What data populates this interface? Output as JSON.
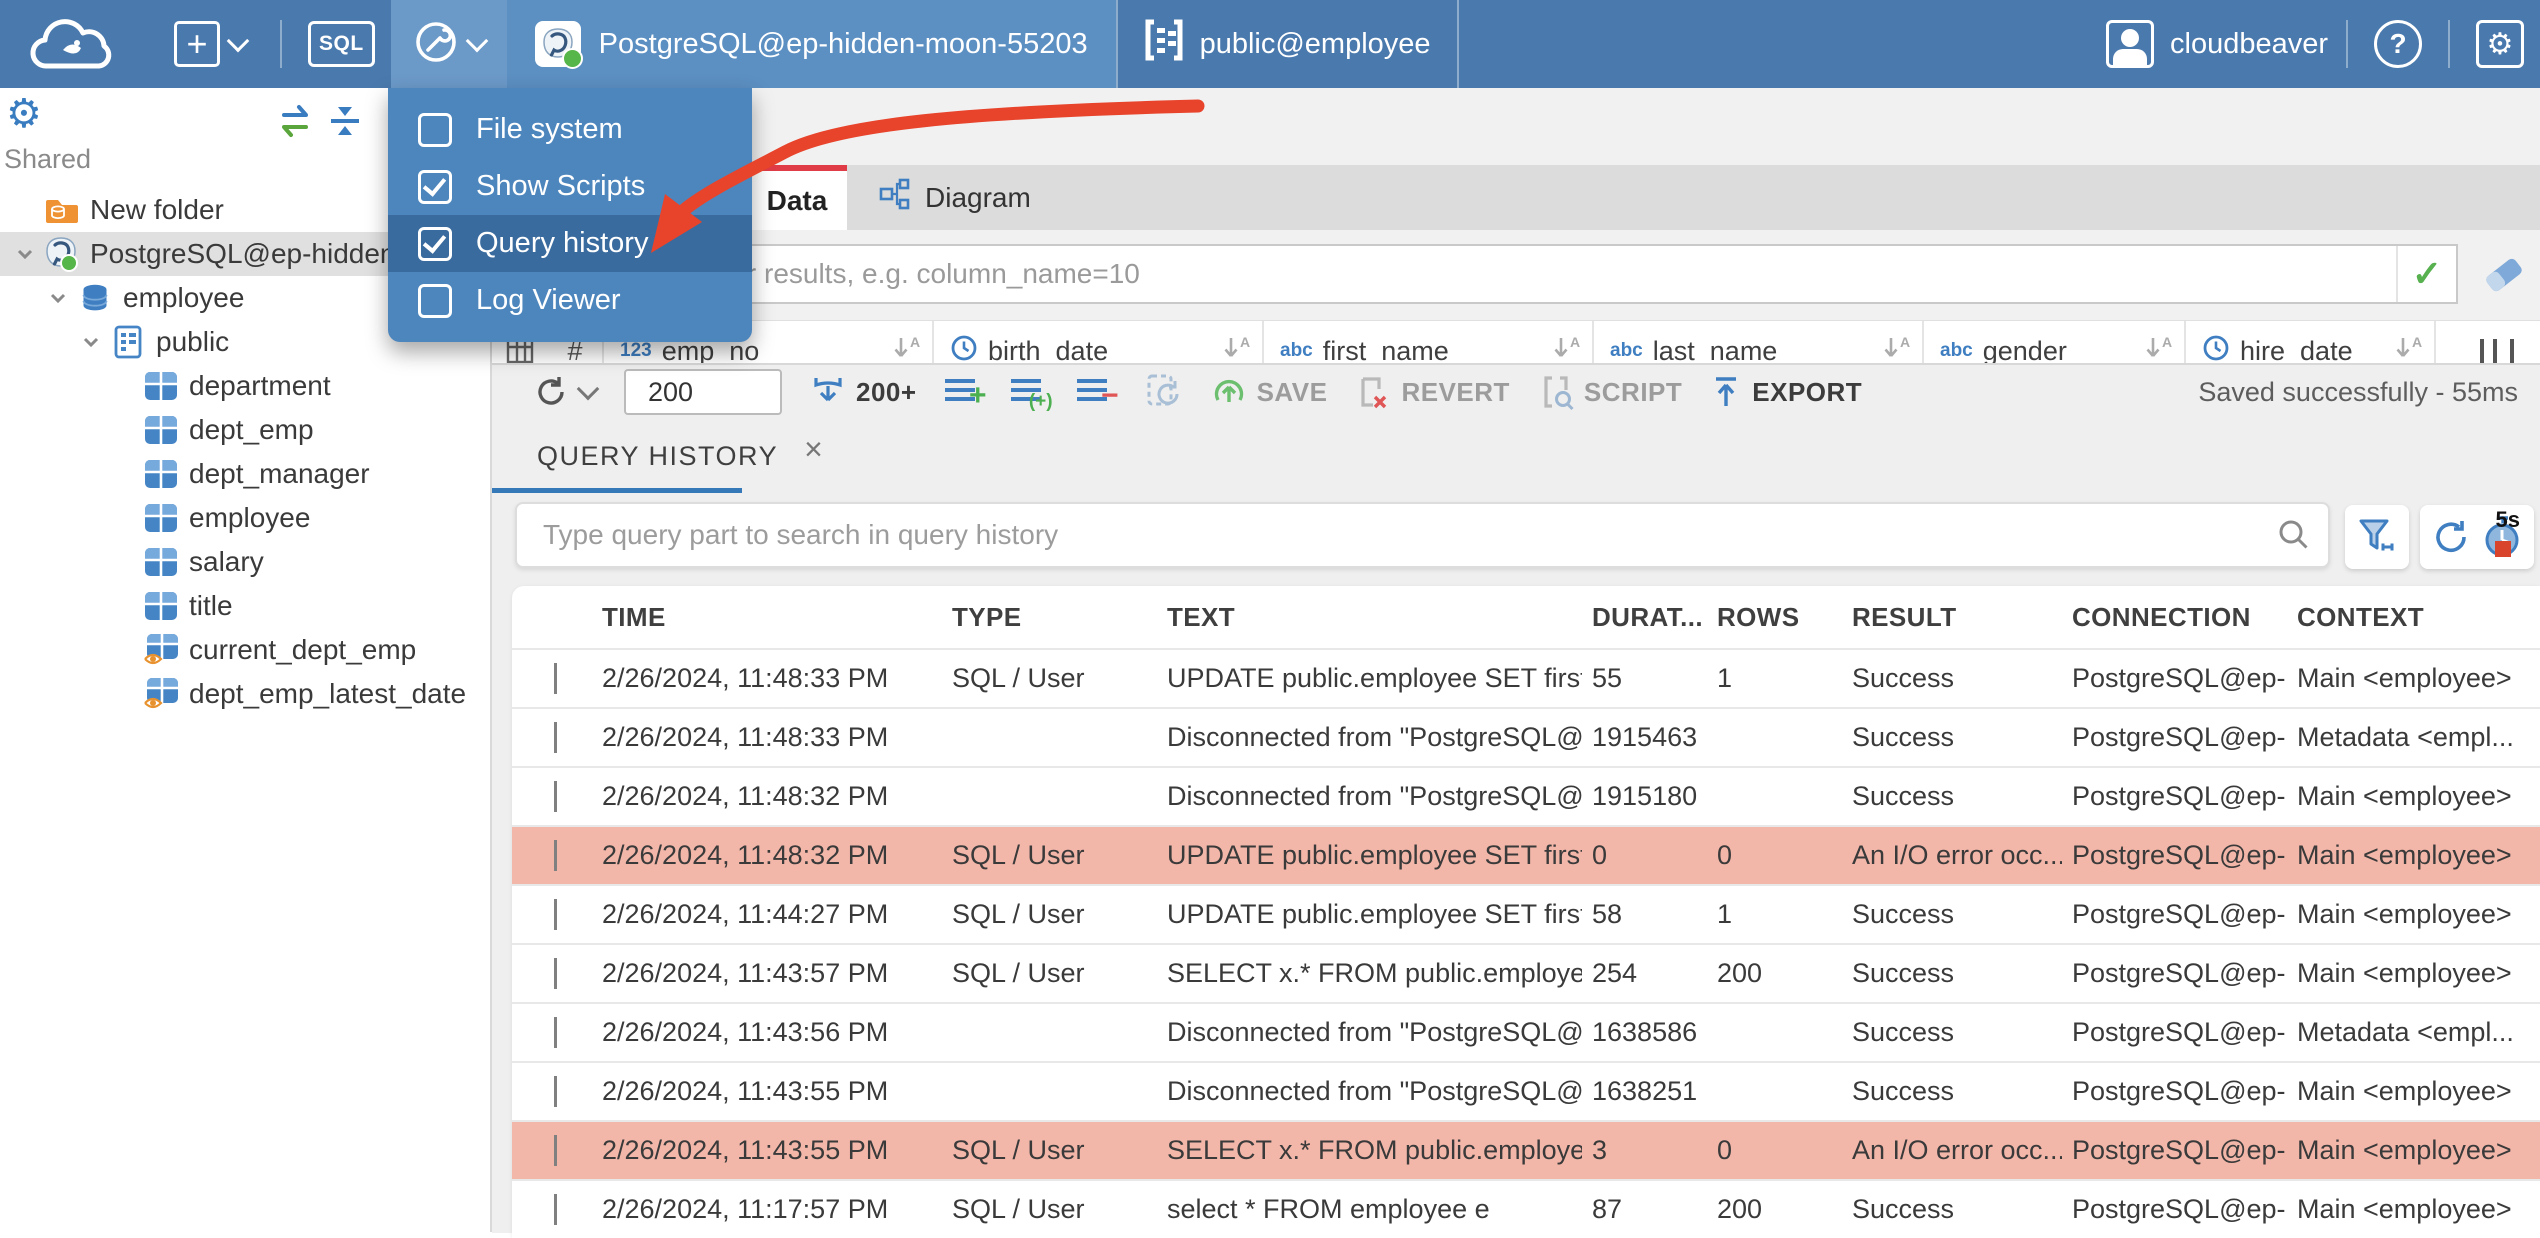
{
  "topbar": {
    "sql_button": "SQL",
    "connection": "PostgreSQL@ep-hidden-moon-55203",
    "schema": "public@employee",
    "user": "cloudbeaver"
  },
  "tools_menu": {
    "items": [
      {
        "label": "File system",
        "checked": false,
        "highlighted": false
      },
      {
        "label": "Show Scripts",
        "checked": true,
        "highlighted": false
      },
      {
        "label": "Query history",
        "checked": true,
        "highlighted": true
      },
      {
        "label": "Log Viewer",
        "checked": false,
        "highlighted": false
      }
    ]
  },
  "sidebar": {
    "section": "Shared",
    "tree": [
      {
        "label": "New folder",
        "icon": "folder",
        "indent": 1,
        "chevron": false,
        "selected": false
      },
      {
        "label": "PostgreSQL@ep-hidden-moon-55203",
        "icon": "postgres",
        "indent": 1,
        "chevron": true,
        "selected": true
      },
      {
        "label": "employee",
        "icon": "database",
        "indent": 2,
        "chevron": true,
        "selected": false
      },
      {
        "label": "public",
        "icon": "schema",
        "indent": 3,
        "chevron": true,
        "selected": false
      },
      {
        "label": "department",
        "icon": "table",
        "indent": 4,
        "chevron": false,
        "selected": false
      },
      {
        "label": "dept_emp",
        "icon": "table",
        "indent": 4,
        "chevron": false,
        "selected": false
      },
      {
        "label": "dept_manager",
        "icon": "table",
        "indent": 4,
        "chevron": false,
        "selected": false
      },
      {
        "label": "employee",
        "icon": "table",
        "indent": 4,
        "chevron": false,
        "selected": false
      },
      {
        "label": "salary",
        "icon": "table",
        "indent": 4,
        "chevron": false,
        "selected": false
      },
      {
        "label": "title",
        "icon": "table",
        "indent": 4,
        "chevron": false,
        "selected": false
      },
      {
        "label": "current_dept_emp",
        "icon": "view",
        "indent": 4,
        "chevron": false,
        "selected": false
      },
      {
        "label": "dept_emp_latest_date",
        "icon": "view",
        "indent": 4,
        "chevron": false,
        "selected": false
      }
    ]
  },
  "main": {
    "tabs": [
      {
        "label": "Data",
        "active": true
      },
      {
        "label": "Diagram",
        "active": false
      }
    ],
    "filter_placeholder": "expression to filter results, e.g. column_name=10",
    "datagrid_columns": [
      {
        "type": "num",
        "label": "emp_no"
      },
      {
        "type": "date",
        "label": "birth_date"
      },
      {
        "type": "text",
        "label": "first_name"
      },
      {
        "type": "text",
        "label": "last_name"
      },
      {
        "type": "text",
        "label": "gender"
      },
      {
        "type": "date",
        "label": "hire_date"
      }
    ],
    "toolbar": {
      "row_count": "200",
      "load_more": "200+",
      "save": "SAVE",
      "revert": "REVERT",
      "script": "SCRIPT",
      "export": "EXPORT",
      "status": "Saved successfully - 55ms"
    }
  },
  "history": {
    "tab": "QUERY HISTORY",
    "search_placeholder": "Type query part to search in query history",
    "refresh_interval": "5s",
    "columns": [
      "TIME",
      "TYPE",
      "TEXT",
      "DURAT...",
      "ROWS",
      "RESULT",
      "CONNECTION",
      "CONTEXT"
    ],
    "rows": [
      {
        "time": "2/26/2024, 11:48:33 PM",
        "type": "SQL / User",
        "text": "UPDATE public.employee SET first_...",
        "duration": "55",
        "rows": "1",
        "result": "Success",
        "connection": "PostgreSQL@ep-...",
        "context": "Main <employee>",
        "error": false
      },
      {
        "time": "2/26/2024, 11:48:33 PM",
        "type": "",
        "text": "Disconnected from \"PostgreSQL@e...",
        "duration": "1915463",
        "rows": "",
        "result": "Success",
        "connection": "PostgreSQL@ep-...",
        "context": "Metadata <empl...",
        "error": false
      },
      {
        "time": "2/26/2024, 11:48:32 PM",
        "type": "",
        "text": "Disconnected from \"PostgreSQL@e...",
        "duration": "1915180",
        "rows": "",
        "result": "Success",
        "connection": "PostgreSQL@ep-...",
        "context": "Main <employee>",
        "error": false
      },
      {
        "time": "2/26/2024, 11:48:32 PM",
        "type": "SQL / User",
        "text": "UPDATE public.employee SET first_...",
        "duration": "0",
        "rows": "0",
        "result": "An I/O error occ...",
        "connection": "PostgreSQL@ep-...",
        "context": "Main <employee>",
        "error": true
      },
      {
        "time": "2/26/2024, 11:44:27 PM",
        "type": "SQL / User",
        "text": "UPDATE public.employee SET first_...",
        "duration": "58",
        "rows": "1",
        "result": "Success",
        "connection": "PostgreSQL@ep-...",
        "context": "Main <employee>",
        "error": false
      },
      {
        "time": "2/26/2024, 11:43:57 PM",
        "type": "SQL / User",
        "text": "SELECT x.* FROM public.employee x",
        "duration": "254",
        "rows": "200",
        "result": "Success",
        "connection": "PostgreSQL@ep-...",
        "context": "Main <employee>",
        "error": false
      },
      {
        "time": "2/26/2024, 11:43:56 PM",
        "type": "",
        "text": "Disconnected from \"PostgreSQL@e...",
        "duration": "1638586",
        "rows": "",
        "result": "Success",
        "connection": "PostgreSQL@ep-...",
        "context": "Metadata <empl...",
        "error": false
      },
      {
        "time": "2/26/2024, 11:43:55 PM",
        "type": "",
        "text": "Disconnected from \"PostgreSQL@e...",
        "duration": "1638251",
        "rows": "",
        "result": "Success",
        "connection": "PostgreSQL@ep-...",
        "context": "Main <employee>",
        "error": false
      },
      {
        "time": "2/26/2024, 11:43:55 PM",
        "type": "SQL / User",
        "text": "SELECT x.* FROM public.employee x",
        "duration": "3",
        "rows": "0",
        "result": "An I/O error occ...",
        "connection": "PostgreSQL@ep-...",
        "context": "Main <employee>",
        "error": true
      },
      {
        "time": "2/26/2024, 11:17:57 PM",
        "type": "SQL / User",
        "text": "select * FROM employee e",
        "duration": "87",
        "rows": "200",
        "result": "Success",
        "connection": "PostgreSQL@ep-...",
        "context": "Main <employee>",
        "error": false
      }
    ]
  },
  "glyphs": {
    "plus": "+",
    "question": "?",
    "gear": "⚙",
    "check": "✓",
    "close": "×",
    "hash": "#"
  },
  "colors": {
    "topbar_blue": "#4a79ad",
    "menu_blue": "#4d86bd",
    "menu_highlight": "#3a6b9e",
    "active_tab_red": "#e03c47",
    "error_row_pink": "#f3b7aa",
    "accent_blue": "#3e7ec1",
    "annotation_arrow_red": "#e8432b",
    "history_tab_underline": "#3579b8"
  }
}
